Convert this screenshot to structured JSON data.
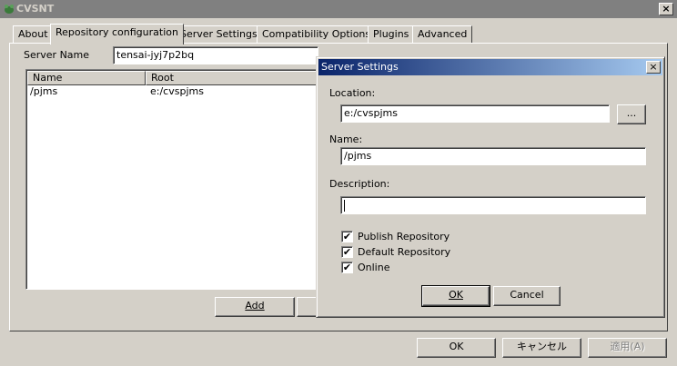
{
  "window": {
    "title": "CVSNT",
    "close_glyph": "×"
  },
  "tabs": [
    {
      "label": "About"
    },
    {
      "label": "Repository configuration"
    },
    {
      "label": "Server Settings"
    },
    {
      "label": "Compatibility Options"
    },
    {
      "label": "Plugins"
    },
    {
      "label": "Advanced"
    }
  ],
  "repo": {
    "server_name_label": "Server Name",
    "server_name_value": "tensai-jyj7p2bq",
    "columns": [
      "Name",
      "Root"
    ],
    "rows": [
      {
        "name": "/pjms",
        "root": "e:/cvspjms"
      }
    ],
    "add_button": "Add"
  },
  "dialog": {
    "title": "Server Settings",
    "close_glyph": "×",
    "location_label": "Location:",
    "location_value": "e:/cvspjms",
    "browse_label": "...",
    "name_label": "Name:",
    "name_value": "/pjms",
    "description_label": "Description:",
    "description_value": "",
    "checkboxes": [
      {
        "label": "Publish Repository",
        "checked": true
      },
      {
        "label": "Default Repository",
        "checked": true
      },
      {
        "label": "Online",
        "checked": true
      }
    ],
    "check_glyph": "✔",
    "ok_label": "OK",
    "cancel_label": "Cancel"
  },
  "footer": {
    "ok_label": "OK",
    "cancel_label": "キャンセル",
    "apply_label": "適用(A)"
  },
  "colors": {
    "face": "#d4d0c8",
    "title_active_start": "#0a246a",
    "title_active_end": "#a6caf0",
    "title_inactive": "#808080"
  }
}
